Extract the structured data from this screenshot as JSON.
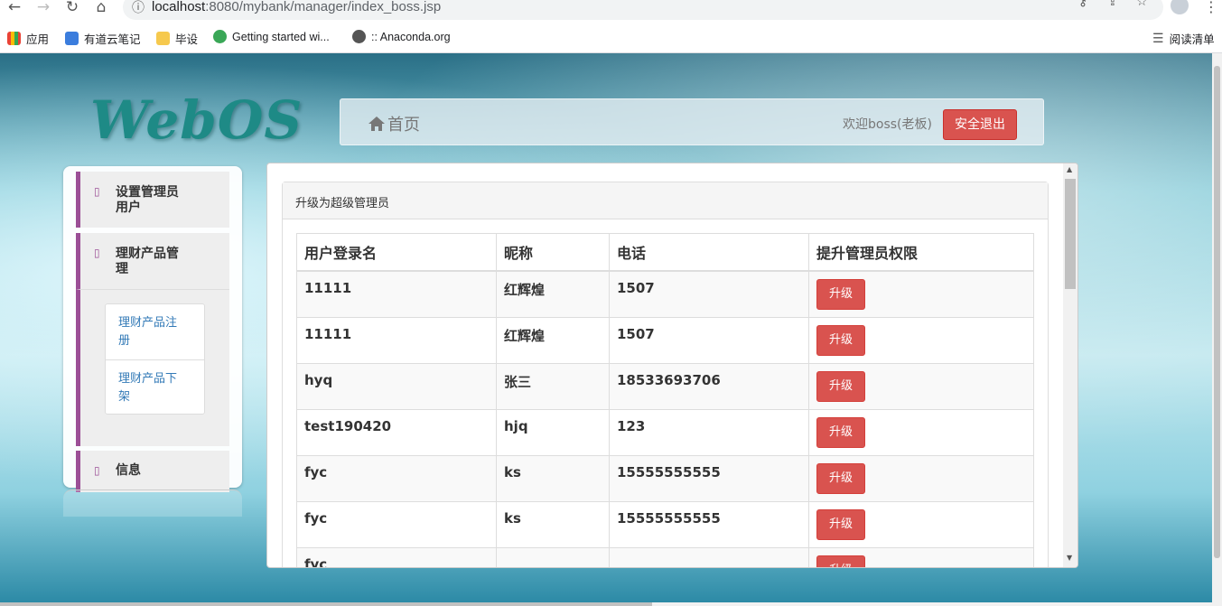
{
  "browser": {
    "url_host": "localhost",
    "url_path": ":8080/mybank/manager/index_boss.jsp",
    "bookmarks": [
      {
        "label": "应用",
        "color": "#4285f4"
      },
      {
        "label": "有道云笔记",
        "color": "#3b7ddd"
      },
      {
        "label": "毕设",
        "color": "#f6c94e"
      },
      {
        "label": "Getting started wi...",
        "color": "#3aa757"
      },
      {
        "label": ":: Anaconda.org",
        "color": "#555555"
      }
    ],
    "reading_list": "阅读清单"
  },
  "header": {
    "logo": "WebOS",
    "home_label": "首页",
    "welcome": "欢迎boss(老板)",
    "logout_label": "安全退出"
  },
  "sidebar": {
    "sections": [
      {
        "label_line1": "设置管理员",
        "label_line2": "用户"
      },
      {
        "label_line1": "理财产品管",
        "label_line2": "理"
      },
      {
        "label_line1": "信息",
        "label_line2": ""
      }
    ],
    "sub_items": [
      {
        "line1": "理财产品注",
        "line2": "册"
      },
      {
        "line1": "理财产品下",
        "line2": "架"
      }
    ],
    "icon_glyph": "▯"
  },
  "main": {
    "panel_title": "升级为超级管理员",
    "columns": [
      "用户登录名",
      "昵称",
      "电话",
      "提升管理员权限"
    ],
    "action_label": "升级",
    "rows": [
      {
        "login": "11111",
        "nick": "红辉煌",
        "phone": "1507"
      },
      {
        "login": "11111",
        "nick": "红辉煌",
        "phone": "1507"
      },
      {
        "login": "hyq",
        "nick": "张三",
        "phone": "18533693706"
      },
      {
        "login": "test190420",
        "nick": "hjq",
        "phone": "123"
      },
      {
        "login": "fyc",
        "nick": "ks",
        "phone": "15555555555"
      },
      {
        "login": "fyc",
        "nick": "ks",
        "phone": "15555555555"
      },
      {
        "login": "fyc",
        "nick": "",
        "phone": ""
      }
    ]
  },
  "colors": {
    "accent_purple": "#9b4f96",
    "danger": "#d9534f",
    "link": "#337ab7"
  }
}
